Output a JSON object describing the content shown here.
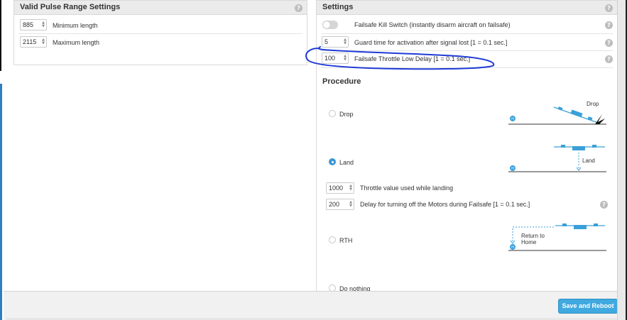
{
  "pulse_range": {
    "title": "Valid Pulse Range Settings",
    "help": "?",
    "min_value": "885",
    "min_label": "Minimum length",
    "max_value": "2115",
    "max_label": "Maximum length"
  },
  "settings": {
    "title": "Settings",
    "help": "?",
    "kill_switch_label": "Failsafe Kill Switch (instantly disarm aircraft on failsafe)",
    "kill_switch_on": false,
    "guard_value": "5",
    "guard_label": "Guard time for activation after signal lost [1 = 0.1 sec.]",
    "throttle_low_value": "100",
    "throttle_low_label": "Failsafe Throttle Low Delay [1 = 0.1 sec.]"
  },
  "procedure": {
    "title": "Procedure",
    "drop_label": "Drop",
    "drop_illus_text": "Drop",
    "land_label": "Land",
    "land_illus_text": "Land",
    "throttle_value": "1000",
    "throttle_label": "Throttle value used while landing",
    "motor_delay_value": "200",
    "motor_delay_label": "Delay for turning off the Motors during Failsafe [1 = 0.1 sec.]",
    "rth_label": "RTH",
    "rth_illus_text_1": "Return to",
    "rth_illus_text_2": "Home",
    "nothing_label": "Do nothing",
    "selected": "land",
    "home_marker": "H"
  },
  "footer": {
    "save_label": "Save and Reboot"
  },
  "colors": {
    "accent": "#3fa9e0",
    "drone": "#3aa0d8",
    "annotation": "#1f3bd6"
  }
}
